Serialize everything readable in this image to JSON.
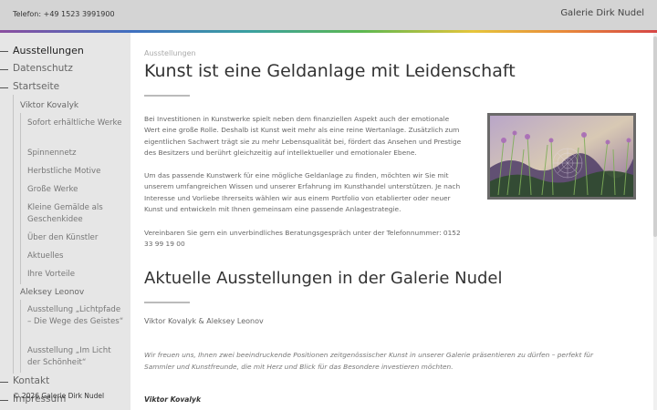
{
  "header": {
    "phone": "Telefon: +49 1523 3991900",
    "brand": "Galerie Dirk Nudel"
  },
  "sidebar": {
    "items": [
      {
        "label": "Ausstellungen"
      },
      {
        "label": "Datenschutz"
      },
      {
        "label": "Startseite"
      },
      {
        "label": "Viktor Kovalyk"
      },
      {
        "label": "Sofort erhältliche Werke"
      },
      {
        "label": "Spinnennetz"
      },
      {
        "label": "Herbstliche Motive"
      },
      {
        "label": "Große Werke"
      },
      {
        "label": "Kleine Gemälde als Geschenkidee"
      },
      {
        "label": "Über den Künstler"
      },
      {
        "label": "Aktuelles"
      },
      {
        "label": "Ihre Vorteile"
      },
      {
        "label": "Aleksey Leonov"
      },
      {
        "label": "Ausstellung „Lichtpfade – Die Wege des Geistes“"
      },
      {
        "label": "Ausstellung „Im Licht der Schönheit“"
      },
      {
        "label": "Kontakt"
      },
      {
        "label": "Impressum"
      }
    ],
    "footer": "© 2026 Galerie Dirk Nudel"
  },
  "main": {
    "breadcrumb": "Ausstellungen",
    "title": "Kunst ist eine Geldanlage mit Leidenschaft",
    "paragraphs": [
      "Bei Investitionen in Kunstwerke spielt neben dem finanziellen Aspekt auch der emotionale Wert eine große Rolle. Deshalb ist Kunst weit mehr als eine reine Wertanlage. Zusätzlich zum eigentlichen Sachwert trägt sie zu mehr Lebensqualität bei, fördert das Ansehen und Prestige des Besitzers und berührt gleichzeitig auf intellektueller und emotionaler Ebene.",
      "Um das passende Kunstwerk für eine mögliche Geldanlage zu finden, möchten wir Sie mit unserem umfangreichen Wissen und unserer Erfahrung im Kunsthandel unterstützen. Je nach Interesse und Vorliebe Ihrerseits wählen wir aus einem Portfolio von etablierter oder neuer Kunst und entwickeln mit Ihnen gemeinsam eine passende Anlagestrategie.",
      "Vereinbaren Sie gern ein unverbindliches Beratungsgespräch unter der Telefonnummer: 0152 33 99 19 00"
    ],
    "section_title": "Aktuelle Ausstellungen in der Galerie Nudel",
    "artists": "Viktor Kovalyk & Aleksey Leonov",
    "intro": "Wir freuen uns, Ihnen zwei beeindruckende Positionen zeitgenössischer Kunst in unserer Galerie präsentieren zu dürfen – perfekt für Sammler und Kunstfreunde, die mit Herz und Blick für das Besondere investieren möchten.",
    "artist_heading": "Viktor Kovalyk"
  },
  "colors": {
    "sidebar_bg": "#e6e6e6",
    "topbar_bg": "#d4d4d4",
    "accent_rainbow": [
      "#8b4fa0",
      "#3f6fc0",
      "#3aa0a0",
      "#5cb850",
      "#e6c53a",
      "#e8893a",
      "#d64545"
    ]
  }
}
